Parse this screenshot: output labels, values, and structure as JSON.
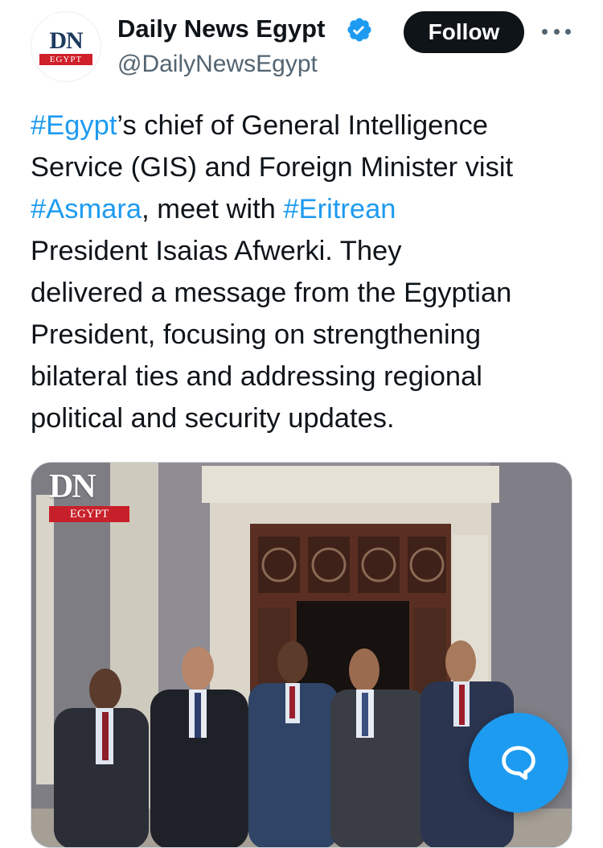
{
  "author": {
    "avatar_text": "DN",
    "avatar_subtext": "EGYPT",
    "name": "Daily News Egypt",
    "handle": "@DailyNewsEgypt",
    "verified_icon": "verified-badge-icon"
  },
  "actions": {
    "follow_label": "Follow",
    "more_icon": "more-icon"
  },
  "tweet": {
    "lines": [
      [
        {
          "text": "#Egypt",
          "tag": true
        },
        {
          "text": "’s chief of General Intelligence",
          "tag": false
        }
      ],
      [
        {
          "text": "Service (GIS) and Foreign Minister visit",
          "tag": false
        }
      ],
      [
        {
          "text": "#Asmara",
          "tag": true
        },
        {
          "text": ", meet with ",
          "tag": false
        },
        {
          "text": "#Eritrean",
          "tag": true
        }
      ],
      [
        {
          "text": "President Isaias Afwerki. They",
          "tag": false
        }
      ],
      [
        {
          "text": "delivered a message from the Egyptian",
          "tag": false
        }
      ],
      [
        {
          "text": "President, focusing on strengthening",
          "tag": false
        }
      ],
      [
        {
          "text": "bilateral ties and addressing regional",
          "tag": false
        }
      ],
      [
        {
          "text": "political and security updates.",
          "tag": false
        }
      ]
    ]
  },
  "media": {
    "watermark_text": "DN",
    "watermark_subtext": "EGYPT"
  },
  "colors": {
    "link": "#1d9bf0",
    "text": "#0f1419",
    "secondary": "#536471",
    "follow_bg": "#0f1419",
    "brand_red": "#d0202a"
  },
  "fab": {
    "icon": "chat-bubble-icon"
  }
}
